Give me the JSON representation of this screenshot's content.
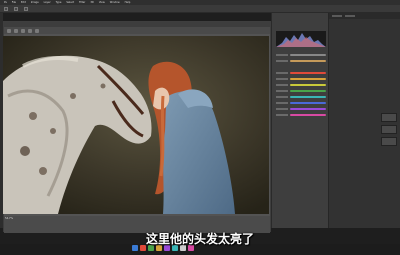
{
  "menu": {
    "items": [
      "Ps",
      "File",
      "Edit",
      "Image",
      "Layer",
      "Type",
      "Select",
      "Filter",
      "3D",
      "View",
      "Window",
      "Help"
    ]
  },
  "dialog": {
    "zoom_label": "54.7%"
  },
  "subtitle": {
    "text": "这里他的头发太亮了"
  },
  "colors": {
    "accent": "#e04a3a",
    "panel_bg": "#3e3e3e",
    "dialog_bg": "#535353",
    "dark_bg": "#1e1e1e"
  },
  "icons": [
    "ps-logo-icon",
    "histogram-icon",
    "tool-icon",
    "layer-thumbnail-icon",
    "dock-app-icon"
  ]
}
